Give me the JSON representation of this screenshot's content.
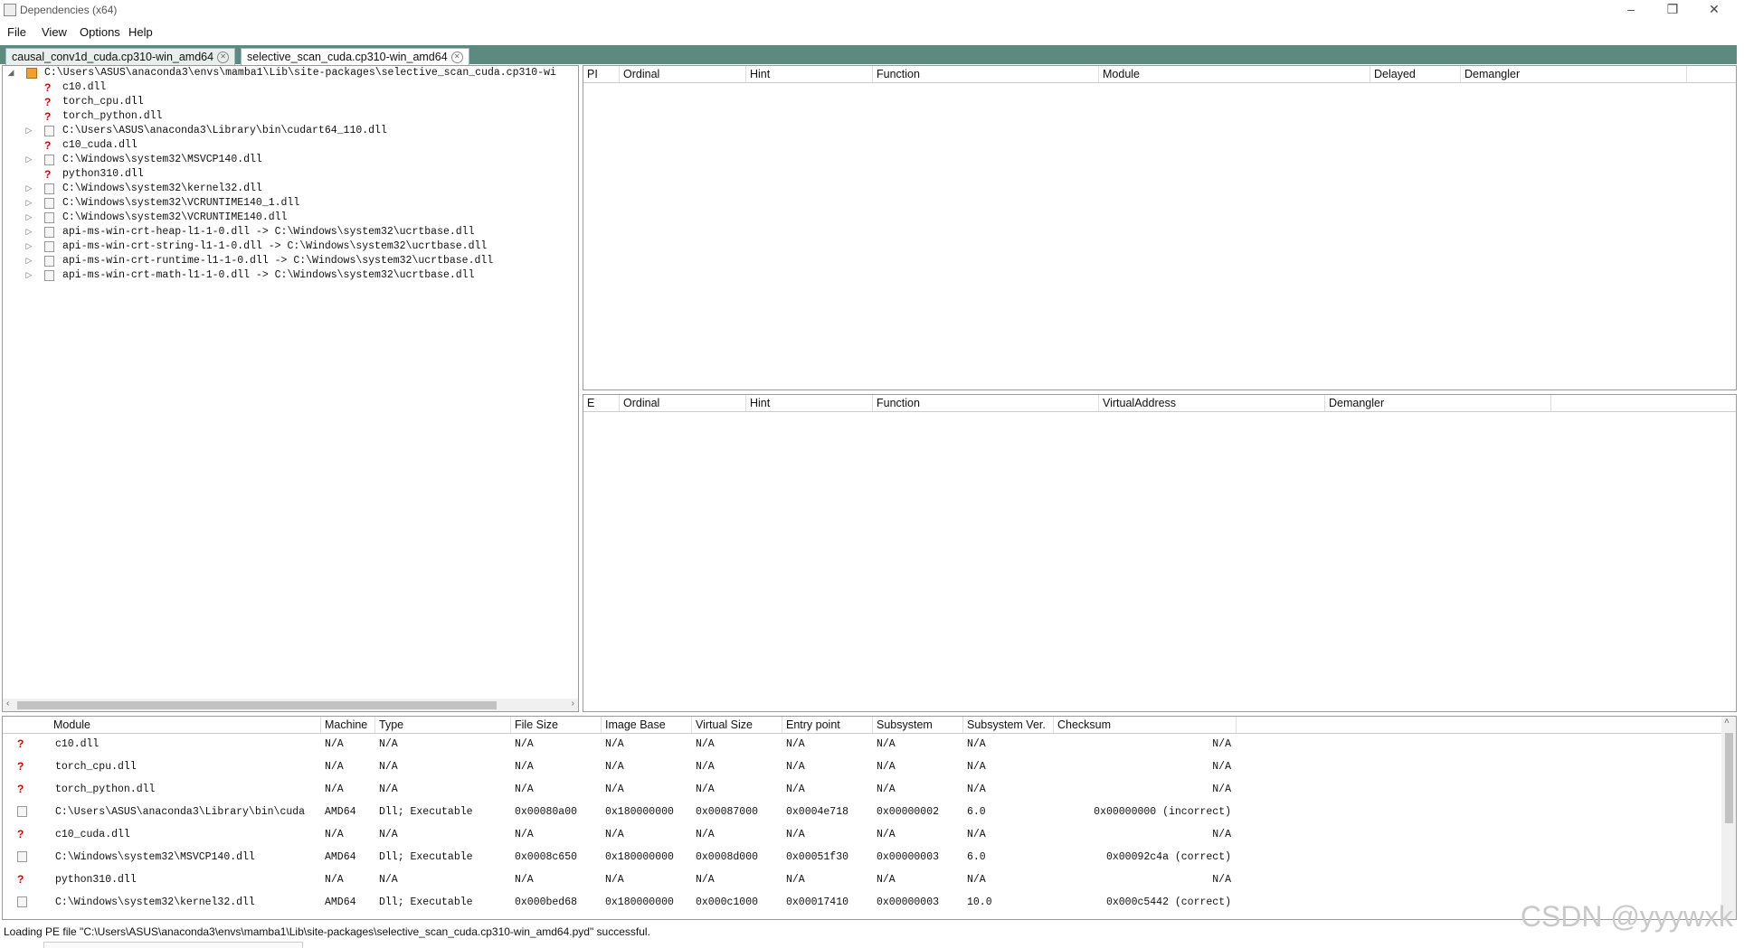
{
  "window": {
    "title": "Dependencies (x64)",
    "minimize_glyph": "–",
    "restore_glyph": "❐",
    "close_glyph": "✕"
  },
  "menu": [
    "File",
    "View",
    "Options",
    "Help"
  ],
  "tabs": [
    {
      "label": "causal_conv1d_cuda.cp310-win_amd64",
      "active": false
    },
    {
      "label": "selective_scan_cuda.cp310-win_amd64",
      "active": true
    }
  ],
  "tree": {
    "root": "C:\\Users\\ASUS\\anaconda3\\envs\\mamba1\\Lib\\site-packages\\selective_scan_cuda.cp310-wi",
    "items": [
      {
        "label": "c10.dll",
        "icon": "missing",
        "expandable": false
      },
      {
        "label": "torch_cpu.dll",
        "icon": "missing",
        "expandable": false
      },
      {
        "label": "torch_python.dll",
        "icon": "missing",
        "expandable": false
      },
      {
        "label": "C:\\Users\\ASUS\\anaconda3\\Library\\bin\\cudart64_110.dll",
        "icon": "file",
        "expandable": true
      },
      {
        "label": "c10_cuda.dll",
        "icon": "missing",
        "expandable": false
      },
      {
        "label": "C:\\Windows\\system32\\MSVCP140.dll",
        "icon": "file",
        "expandable": true
      },
      {
        "label": "python310.dll",
        "icon": "missing",
        "expandable": false
      },
      {
        "label": "C:\\Windows\\system32\\kernel32.dll",
        "icon": "file",
        "expandable": true
      },
      {
        "label": "C:\\Windows\\system32\\VCRUNTIME140_1.dll",
        "icon": "file",
        "expandable": true
      },
      {
        "label": "C:\\Windows\\system32\\VCRUNTIME140.dll",
        "icon": "file",
        "expandable": true
      },
      {
        "label": "api-ms-win-crt-heap-l1-1-0.dll -> C:\\Windows\\system32\\ucrtbase.dll",
        "icon": "file",
        "expandable": true
      },
      {
        "label": "api-ms-win-crt-string-l1-1-0.dll -> C:\\Windows\\system32\\ucrtbase.dll",
        "icon": "file",
        "expandable": true
      },
      {
        "label": "api-ms-win-crt-runtime-l1-1-0.dll -> C:\\Windows\\system32\\ucrtbase.dll",
        "icon": "file",
        "expandable": true
      },
      {
        "label": "api-ms-win-crt-math-l1-1-0.dll -> C:\\Windows\\system32\\ucrtbase.dll",
        "icon": "file",
        "expandable": true
      }
    ]
  },
  "imports_columns": [
    "PI",
    "Ordinal",
    "Hint",
    "Function",
    "Module",
    "Delayed",
    "Demangler"
  ],
  "exports_columns": [
    "E",
    "Ordinal",
    "Hint",
    "Function",
    "VirtualAddress",
    "Demangler"
  ],
  "modules_columns": [
    "Module",
    "Machine",
    "Type",
    "File Size",
    "Image Base",
    "Virtual Size",
    "Entry point",
    "Subsystem",
    "Subsystem Ver.",
    "Checksum"
  ],
  "modules": [
    {
      "icon": "missing",
      "cells": [
        "c10.dll",
        "N/A",
        "N/A",
        "N/A",
        "N/A",
        "N/A",
        "N/A",
        "N/A",
        "N/A",
        "N/A"
      ]
    },
    {
      "icon": "missing",
      "cells": [
        "torch_cpu.dll",
        "N/A",
        "N/A",
        "N/A",
        "N/A",
        "N/A",
        "N/A",
        "N/A",
        "N/A",
        "N/A"
      ]
    },
    {
      "icon": "missing",
      "cells": [
        "torch_python.dll",
        "N/A",
        "N/A",
        "N/A",
        "N/A",
        "N/A",
        "N/A",
        "N/A",
        "N/A",
        "N/A"
      ]
    },
    {
      "icon": "file",
      "cells": [
        "C:\\Users\\ASUS\\anaconda3\\Library\\bin\\cuda",
        "AMD64",
        "Dll; Executable",
        "0x00080a00",
        "0x180000000",
        "0x00087000",
        "0x0004e718",
        "0x00000002",
        "6.0",
        "0x00000000 (incorrect)"
      ]
    },
    {
      "icon": "missing",
      "cells": [
        "c10_cuda.dll",
        "N/A",
        "N/A",
        "N/A",
        "N/A",
        "N/A",
        "N/A",
        "N/A",
        "N/A",
        "N/A"
      ]
    },
    {
      "icon": "file",
      "cells": [
        "C:\\Windows\\system32\\MSVCP140.dll",
        "AMD64",
        "Dll; Executable",
        "0x0008c650",
        "0x180000000",
        "0x0008d000",
        "0x00051f30",
        "0x00000003",
        "6.0",
        "0x00092c4a (correct)"
      ]
    },
    {
      "icon": "missing",
      "cells": [
        "python310.dll",
        "N/A",
        "N/A",
        "N/A",
        "N/A",
        "N/A",
        "N/A",
        "N/A",
        "N/A",
        "N/A"
      ]
    },
    {
      "icon": "file",
      "cells": [
        "C:\\Windows\\system32\\kernel32.dll",
        "AMD64",
        "Dll; Executable",
        "0x000bed68",
        "0x180000000",
        "0x000c1000",
        "0x00017410",
        "0x00000003",
        "10.0",
        "0x000c5442 (correct)"
      ]
    }
  ],
  "status": "Loading PE file \"C:\\Users\\ASUS\\anaconda3\\envs\\mamba1\\Lib\\site-packages\\selective_scan_cuda.cp310-win_amd64.pyd\" successful.",
  "watermark": "CSDN @yyywxk",
  "icons": {
    "missing": "?",
    "expand": "▷",
    "collapse": "◢",
    "scroll_left": "‹",
    "scroll_right": "›",
    "scroll_up": "˄"
  }
}
